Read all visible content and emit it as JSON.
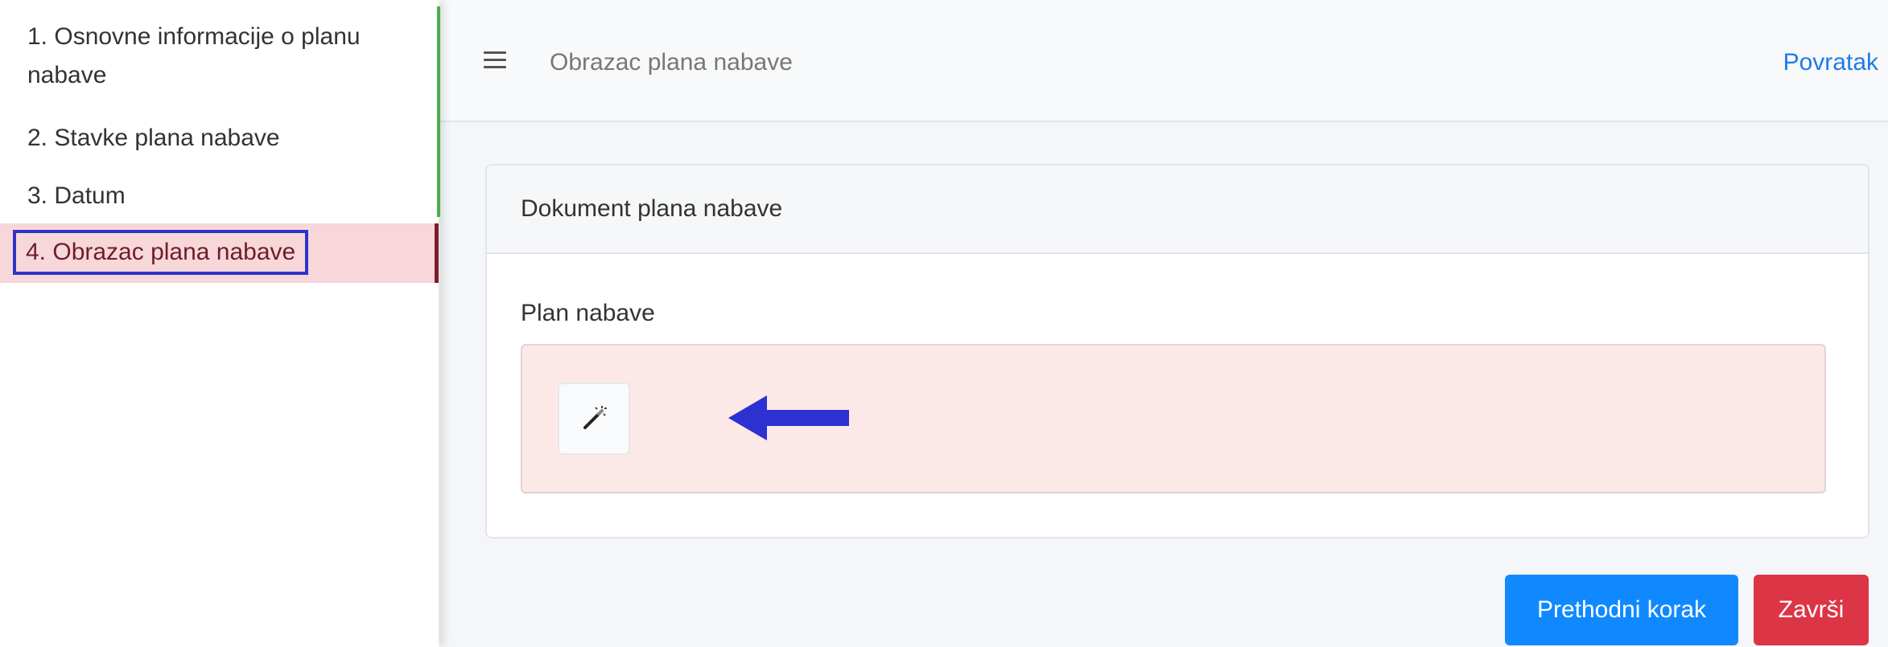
{
  "sidebar": {
    "steps": [
      {
        "label": "1. Osnovne informacije o planu",
        "label_cont": "nabave"
      },
      {
        "label": "2. Stavke plana nabave"
      },
      {
        "label": "3. Datum"
      },
      {
        "label": "4. Obrazac plana nabave",
        "active": true
      }
    ]
  },
  "header": {
    "menu_icon": "hamburger-menu-icon",
    "title": "Obrazac plana nabave",
    "back_link": "Povratak"
  },
  "card": {
    "title": "Dokument plana nabave",
    "field_label": "Plan nabave",
    "upload_icon": "magic-wand-icon",
    "annotation_icon": "arrow-left-icon"
  },
  "actions": {
    "previous": "Prethodni korak",
    "finish": "Završi"
  },
  "colors": {
    "primary": "#1089ff",
    "danger": "#dc3545",
    "active_step_bg": "#f8d7da",
    "highlight_border": "#2f33c9",
    "progress_line": "#4cae4c"
  }
}
